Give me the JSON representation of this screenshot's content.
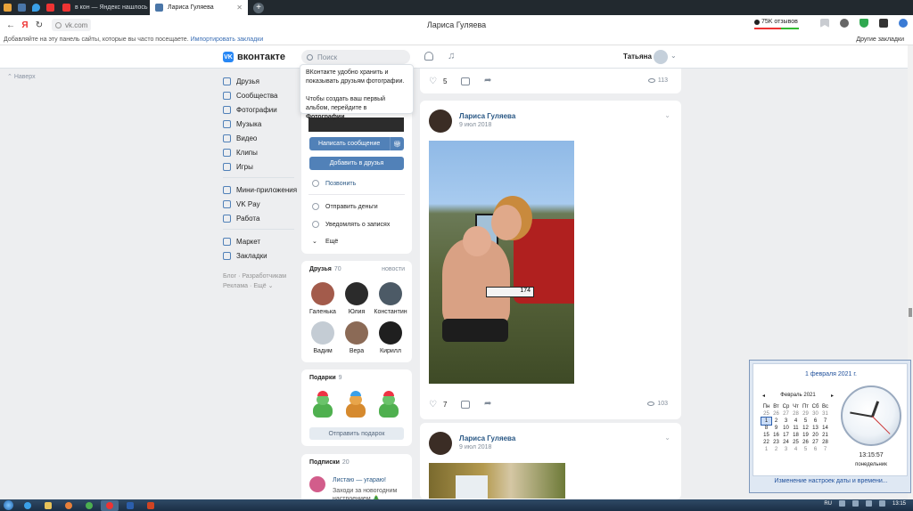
{
  "browser": {
    "tabs": [
      {
        "label": "в кон — Яндекс нашлось",
        "active": false
      },
      {
        "label": "Лариса Гуляева",
        "active": true
      }
    ],
    "url": "vk.com",
    "page_title": "Лариса Гуляева",
    "reviews_badge": "75K отзывов",
    "bookmarks_bar": {
      "hint": "Добавляйте на эту панель сайты, которые вы часто посещаете.",
      "import_link": "Импортировать закладки",
      "other": "Другие закладки"
    }
  },
  "vk": {
    "logo_text": "вконтакте",
    "search_placeholder": "Поиск",
    "user_name": "Татьяна",
    "back_to_top": "Наверх",
    "nav": [
      {
        "label": "Друзья",
        "icon": "friends-icon"
      },
      {
        "label": "Сообщества",
        "icon": "communities-icon"
      },
      {
        "label": "Фотографии",
        "icon": "photos-icon"
      },
      {
        "label": "Музыка",
        "icon": "music-icon"
      },
      {
        "label": "Видео",
        "icon": "video-icon"
      },
      {
        "label": "Клипы",
        "icon": "clips-icon"
      },
      {
        "label": "Игры",
        "icon": "games-icon"
      }
    ],
    "nav2": [
      {
        "label": "Мини-приложения",
        "icon": "apps-icon"
      },
      {
        "label": "VK Pay",
        "icon": "vkpay-icon"
      },
      {
        "label": "Работа",
        "icon": "work-icon"
      }
    ],
    "nav3": [
      {
        "label": "Маркет",
        "icon": "market-icon"
      },
      {
        "label": "Закладки",
        "icon": "bookmarks-icon"
      }
    ],
    "footer": {
      "l1a": "Блог",
      "l1b": "Разработчикам",
      "l2a": "Реклама",
      "l2b": "Ещё"
    },
    "tooltip": {
      "line1": "ВКонтакте удобно хранить и показывать друзьям фотографии.",
      "line2_pre": "Чтобы создать ваш первый альбом, перейдите в ",
      "line2_bold": "Фотографии",
      "line2_post": "."
    },
    "profile": {
      "send_message": "Написать сообщение",
      "add_friend": "Добавить в друзья",
      "call": "Позвонить",
      "send_money": "Отправить деньги",
      "notify": "Уведомлять о записях",
      "more": "Ещё"
    },
    "friends": {
      "title": "Друзья",
      "count": "70",
      "link": "новости",
      "items": [
        "Галенька",
        "Юлия",
        "Константин",
        "Вадим",
        "Вера",
        "Кирилл"
      ]
    },
    "gifts": {
      "title": "Подарки",
      "count": "9",
      "button": "Отправить подарок"
    },
    "subs": {
      "title": "Подписки",
      "count": "20",
      "item_name": "Листаю — угараю!",
      "item_desc": "Заходи за новогодним настроением 🎄"
    },
    "posts": [
      {
        "likes": "5",
        "views": "113"
      },
      {
        "author": "Лариса Гуляева",
        "date": "9 июл 2018",
        "plate": "174",
        "likes": "7",
        "views": "103"
      },
      {
        "author": "Лариса Гуляева",
        "date": "9 июл 2018"
      }
    ]
  },
  "calendar": {
    "title": "1 февраля 2021 г.",
    "month": "Февраль 2021",
    "weekdays": [
      "Пн",
      "Вт",
      "Ср",
      "Чт",
      "Пт",
      "Сб",
      "Вс"
    ],
    "weeks": [
      [
        "25",
        "26",
        "27",
        "28",
        "29",
        "30",
        "31"
      ],
      [
        "1",
        "2",
        "3",
        "4",
        "5",
        "6",
        "7"
      ],
      [
        "8",
        "9",
        "10",
        "11",
        "12",
        "13",
        "14"
      ],
      [
        "15",
        "16",
        "17",
        "18",
        "19",
        "20",
        "21"
      ],
      [
        "22",
        "23",
        "24",
        "25",
        "26",
        "27",
        "28"
      ],
      [
        "1",
        "2",
        "3",
        "4",
        "5",
        "6",
        "7"
      ]
    ],
    "time": "13:15:57",
    "day": "понедельник",
    "link": "Изменение настроек даты и времени..."
  },
  "taskbar": {
    "lang": "RU",
    "clock": "13:15"
  },
  "colors": {
    "vk_blue": "#5181b8",
    "vk_link": "#2a5885",
    "bg": "#edeef0"
  }
}
